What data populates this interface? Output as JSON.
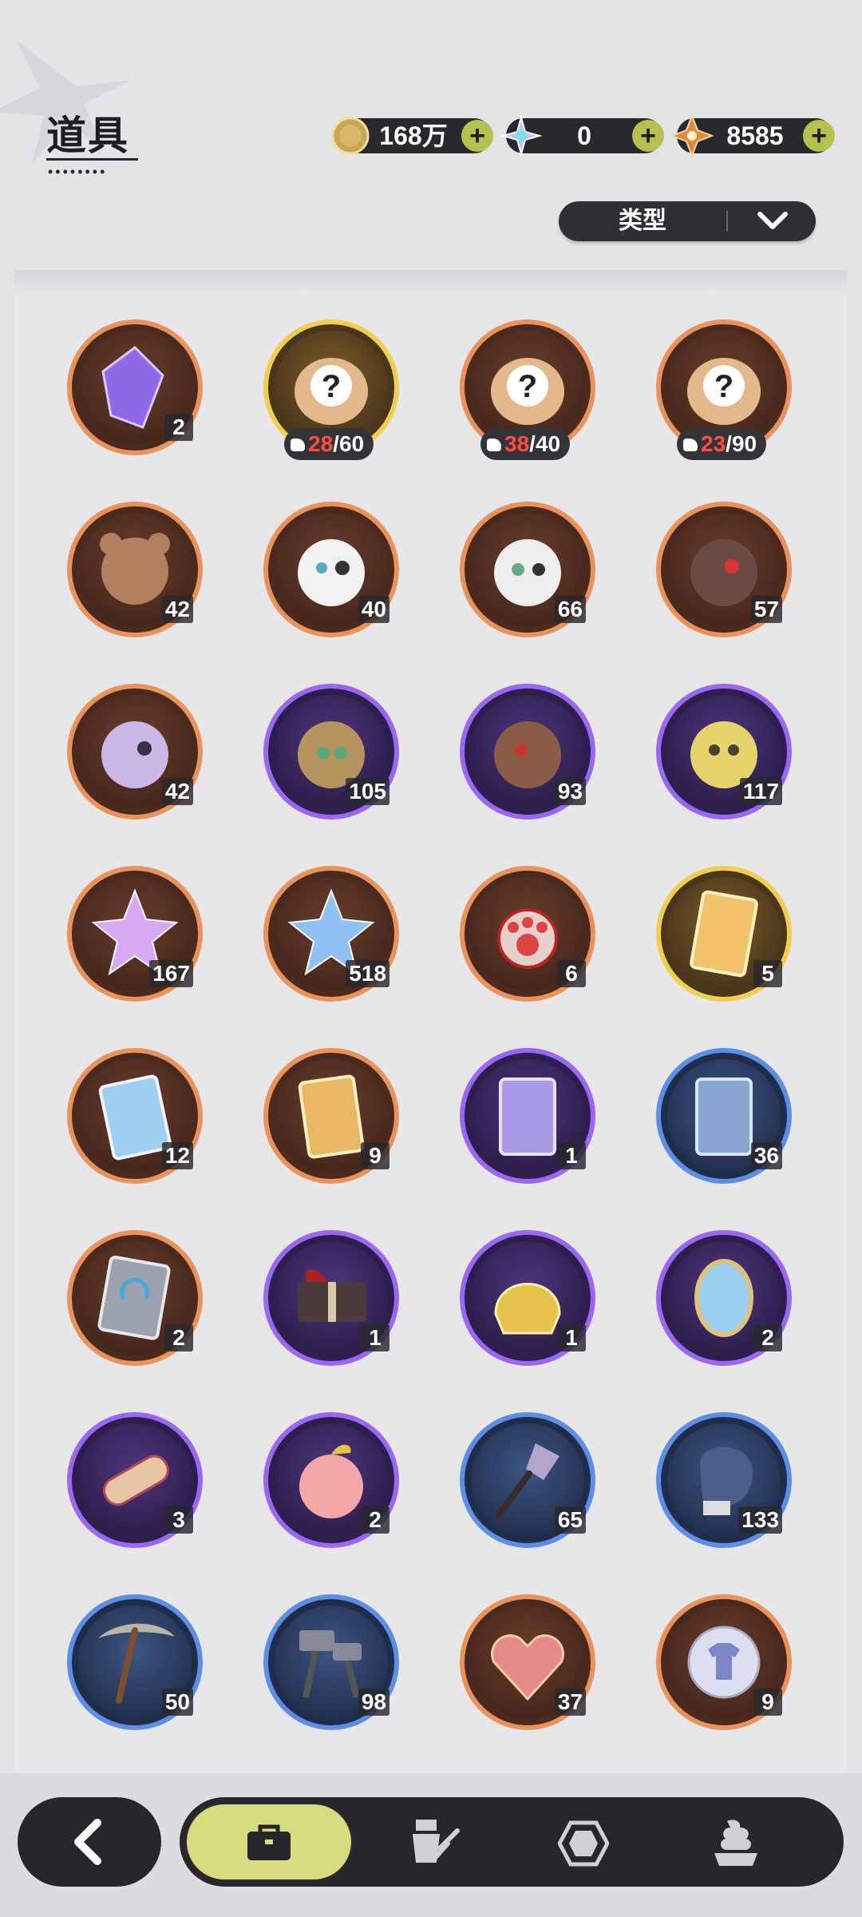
{
  "header": {
    "title": "道具",
    "currencies": [
      {
        "icon": "gold-coin-icon",
        "value": "168万"
      },
      {
        "icon": "crystal-flower-icon",
        "value": "0"
      },
      {
        "icon": "star-gem-icon",
        "value": "8585"
      }
    ],
    "filter_label": "类型"
  },
  "items": [
    {
      "icon": "purple-crystal-icon",
      "tier": "orange",
      "count": "2"
    },
    {
      "icon": "mystery-plush-icon",
      "tier": "gold",
      "have": "28",
      "need": "60"
    },
    {
      "icon": "mystery-plush-icon",
      "tier": "orange",
      "have": "38",
      "need": "40"
    },
    {
      "icon": "mystery-plush-icon",
      "tier": "orange",
      "have": "23",
      "need": "90"
    },
    {
      "icon": "bear-plush-icon",
      "tier": "orange",
      "count": "42"
    },
    {
      "icon": "white-bunny-plush-icon",
      "tier": "orange",
      "count": "40"
    },
    {
      "icon": "green-eye-plush-icon",
      "tier": "orange",
      "count": "66"
    },
    {
      "icon": "red-eye-bear-plush-icon",
      "tier": "orange",
      "count": "57"
    },
    {
      "icon": "lavender-cat-plush-icon",
      "tier": "orange",
      "count": "42"
    },
    {
      "icon": "green-bear-plush-icon",
      "tier": "purple",
      "count": "105"
    },
    {
      "icon": "brown-bear-plush-icon",
      "tier": "purple",
      "count": "93"
    },
    {
      "icon": "yellow-fish-plush-icon",
      "tier": "purple",
      "count": "117"
    },
    {
      "icon": "pink-star-crystal-icon",
      "tier": "orange",
      "count": "167"
    },
    {
      "icon": "blue-star-crystal-icon",
      "tier": "orange",
      "count": "518"
    },
    {
      "icon": "paw-charm-icon",
      "tier": "orange",
      "count": "6"
    },
    {
      "icon": "gold-character-card-icon",
      "tier": "gold",
      "count": "5"
    },
    {
      "icon": "holo-card-icon",
      "tier": "orange",
      "count": "12"
    },
    {
      "icon": "golden-card-icon",
      "tier": "orange",
      "count": "9"
    },
    {
      "icon": "purple-card-icon",
      "tier": "purple",
      "count": "1"
    },
    {
      "icon": "blue-card-icon",
      "tier": "blue",
      "count": "36"
    },
    {
      "icon": "refresh-book-icon",
      "tier": "orange",
      "count": "2"
    },
    {
      "icon": "gift-box-icon",
      "tier": "purple",
      "count": "1"
    },
    {
      "icon": "golden-helmet-icon",
      "tier": "purple",
      "count": "1"
    },
    {
      "icon": "magic-mirror-icon",
      "tier": "purple",
      "count": "2"
    },
    {
      "icon": "scroll-icon",
      "tier": "purple",
      "count": "3"
    },
    {
      "icon": "apple-icon",
      "tier": "purple",
      "count": "2"
    },
    {
      "icon": "shovel-icon",
      "tier": "blue",
      "count": "65"
    },
    {
      "icon": "boxing-glove-icon",
      "tier": "blue",
      "count": "133"
    },
    {
      "icon": "pickaxe-icon",
      "tier": "blue",
      "count": "50"
    },
    {
      "icon": "hammer-icon",
      "tier": "blue",
      "count": "98"
    },
    {
      "icon": "ruby-heart-icon",
      "tier": "orange",
      "count": "37"
    },
    {
      "icon": "shirt-token-icon",
      "tier": "orange",
      "count": "9"
    }
  ],
  "tier_colors": {
    "orange": "#e9925a",
    "purple": "#9a66f2",
    "blue": "#5d8ee6",
    "gold": "#f0cf4d"
  },
  "nav": {
    "back_icon": "back-arrow-icon",
    "tabs": [
      {
        "icon": "bag-icon",
        "active": true
      },
      {
        "icon": "outfit-icon",
        "active": false
      },
      {
        "icon": "hexagon-gem-icon",
        "active": false
      },
      {
        "icon": "dessert-icon",
        "active": false
      }
    ]
  }
}
